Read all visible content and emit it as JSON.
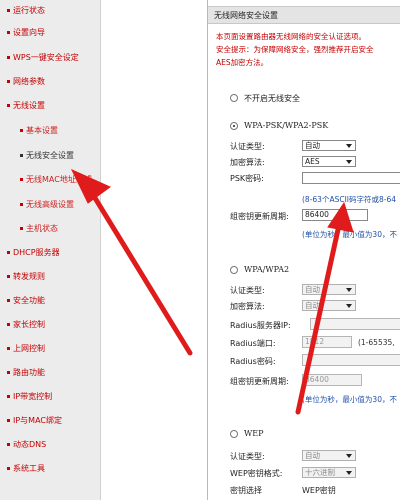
{
  "menu": {
    "items": [
      {
        "label": "运行状态",
        "type": "top"
      },
      {
        "label": "设置向导",
        "type": "top"
      },
      {
        "label": "WPS一键安全设定",
        "type": "top"
      },
      {
        "label": "网络参数",
        "type": "top"
      },
      {
        "label": "无线设置",
        "type": "top"
      },
      {
        "label": "基本设置",
        "type": "sub"
      },
      {
        "label": "无线安全设置",
        "type": "sub-active"
      },
      {
        "label": "无线MAC地址过滤",
        "type": "sub"
      },
      {
        "label": "无线高级设置",
        "type": "sub"
      },
      {
        "label": "主机状态",
        "type": "sub"
      },
      {
        "label": "DHCP服务器",
        "type": "top"
      },
      {
        "label": "转发规则",
        "type": "top"
      },
      {
        "label": "安全功能",
        "type": "top"
      },
      {
        "label": "家长控制",
        "type": "top"
      },
      {
        "label": "上网控制",
        "type": "top"
      },
      {
        "label": "路由功能",
        "type": "top"
      },
      {
        "label": "IP带宽控制",
        "type": "top"
      },
      {
        "label": "IP与MAC绑定",
        "type": "top"
      },
      {
        "label": "动态DNS",
        "type": "top"
      },
      {
        "label": "系统工具",
        "type": "top"
      }
    ]
  },
  "panel": {
    "title": "无线网络安全设置",
    "intro": [
      "本页面设置路由器无线网络的安全认证选项。",
      "安全提示：为保障网络安全，强烈推荐开启安全",
      "AES加密方法。"
    ],
    "none_option": "不开启无线安全",
    "wpa_psk": {
      "title": "WPA-PSK/WPA2-PSK",
      "auth_label": "认证类型:",
      "auth_value": "自动",
      "enc_label": "加密算法:",
      "enc_value": "AES",
      "psk_label": "PSK密码:",
      "psk_value": "",
      "psk_hint": "(8-63个ASCII码字符或8-64",
      "renew_label": "组密钥更新周期:",
      "renew_value": "86400",
      "renew_hint": "(单位为秒，最小值为30，不"
    },
    "wpa": {
      "title": "WPA/WPA2",
      "auth_label": "认证类型:",
      "auth_value": "自动",
      "enc_label": "加密算法:",
      "enc_value": "自动",
      "radius_ip_label": "Radius服务器IP:",
      "radius_port_label": "Radius端口:",
      "radius_port_value": "1812",
      "radius_port_hint": "(1-65535,",
      "radius_pwd_label": "Radius密码:",
      "renew_label": "组密钥更新周期:",
      "renew_value": "86400",
      "renew_hint": "(单位为秒，最小值为30，不"
    },
    "wep": {
      "title": "WEP",
      "auth_label": "认证类型:",
      "auth_value": "自动",
      "format_label": "WEP密钥格式:",
      "format_value": "十六进制",
      "key_select_label": "密钥选择",
      "key_label": "WEP密钥"
    }
  },
  "colors": {
    "menu_text": "#c40000",
    "arrow": "#e01b1b",
    "hint": "#1f4fa8"
  }
}
